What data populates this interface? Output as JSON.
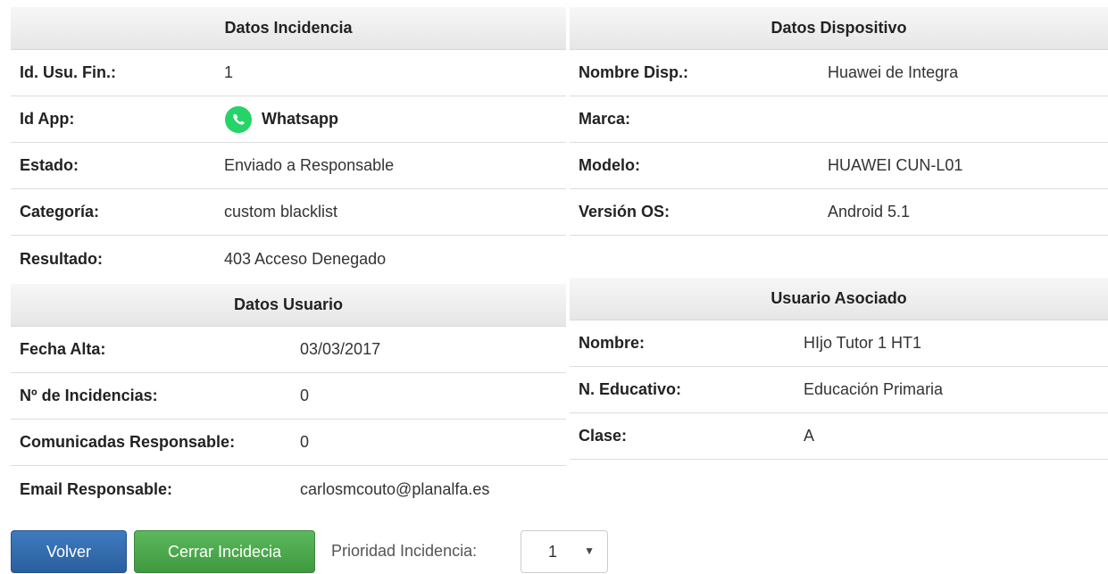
{
  "incidencia": {
    "title": "Datos Incidencia",
    "rows": [
      {
        "label": "Id. Usu. Fin.:",
        "value": "1"
      },
      {
        "label": "Id App:",
        "value": "Whatsapp"
      },
      {
        "label": "Estado:",
        "value": "Enviado a Responsable"
      },
      {
        "label": "Categoría:",
        "value": "custom blacklist"
      },
      {
        "label": "Resultado:",
        "value": "403 Acceso Denegado"
      }
    ]
  },
  "usuario": {
    "title": "Datos Usuario",
    "rows": [
      {
        "label": "Fecha Alta:",
        "value": "03/03/2017"
      },
      {
        "label": "Nº de Incidencias:",
        "value": "0"
      },
      {
        "label": "Comunicadas Responsable:",
        "value": "0"
      },
      {
        "label": "Email Responsable:",
        "value": "carlosmcouto@planalfa.es"
      }
    ]
  },
  "dispositivo": {
    "title": "Datos Dispositivo",
    "rows": [
      {
        "label": "Nombre Disp.:",
        "value": "Huawei de Integra"
      },
      {
        "label": "Marca:",
        "value": ""
      },
      {
        "label": "Modelo:",
        "value": "HUAWEI CUN-L01"
      },
      {
        "label": "Versión OS:",
        "value": "Android 5.1"
      }
    ]
  },
  "asociado": {
    "title": "Usuario Asociado",
    "rows": [
      {
        "label": "Nombre:",
        "value": "HIjo Tutor 1 HT1"
      },
      {
        "label": "N. Educativo:",
        "value": "Educación Primaria"
      },
      {
        "label": "Clase:",
        "value": "A"
      }
    ]
  },
  "actions": {
    "volver_label": "Volver",
    "cerrar_label": "Cerrar Incidecia",
    "prioridad_label": "Prioridad Incidencia:",
    "prioridad_value": "1"
  },
  "icons": {
    "app": "whatsapp-icon",
    "dropdown": "caret-down-icon"
  },
  "colors": {
    "primary_button": "#2f6aad",
    "success_button": "#4cae4c",
    "whatsapp": "#25d366"
  }
}
